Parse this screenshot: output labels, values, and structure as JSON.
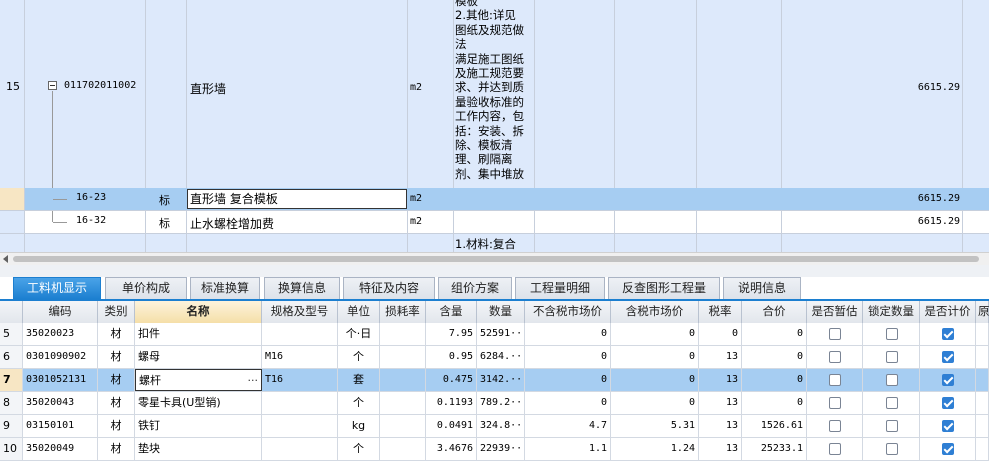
{
  "upper": {
    "row15": {
      "index": "15",
      "code": "011702011002",
      "name": "直形墙",
      "unit": "m2",
      "desc": [
        "模板",
        "2.其他:详见",
        "图纸及规范做",
        "法",
        "满足施工图纸",
        "及施工规范要",
        "求、并达到质",
        "量验收标准的",
        "工作内容，包",
        "括：安装、拆",
        "除、模板清",
        "理、刷隔离",
        "剂、集中堆放"
      ],
      "amount": "6615.29"
    },
    "sub_rows": [
      {
        "code": "16-23",
        "type": "标",
        "name": "直形墙 复合模板",
        "unit": "m2",
        "amount": "6615.29"
      },
      {
        "code": "16-32",
        "type": "标",
        "name": "止水螺栓增加费",
        "unit": "m2",
        "amount": "6615.29"
      }
    ],
    "next_desc": "1.材料:复合"
  },
  "tabs": [
    "工料机显示",
    "单价构成",
    "标准换算",
    "换算信息",
    "特征及内容",
    "组价方案",
    "工程量明细",
    "反查图形工程量",
    "说明信息"
  ],
  "columns": [
    "编码",
    "类别",
    "名称",
    "规格及型号",
    "单位",
    "损耗率",
    "含量",
    "数量",
    "不含税市场价",
    "含税市场价",
    "税率",
    "合价",
    "是否暂估",
    "锁定数量",
    "是否计价",
    "原"
  ],
  "rows": [
    {
      "idx": "5",
      "code": "35020023",
      "type": "材",
      "name": "扣件",
      "spec": "",
      "unit": "个·日",
      "loss": "",
      "content": "7.95",
      "qty": "52591···",
      "price_ex": "0",
      "price_in": "0",
      "tax": "0",
      "total": "0",
      "est": false,
      "lock": false,
      "priced": true
    },
    {
      "idx": "6",
      "code": "0301090902",
      "type": "材",
      "name": "螺母",
      "spec": "M16",
      "unit": "个",
      "loss": "",
      "content": "0.95",
      "qty": "6284.···",
      "price_ex": "0",
      "price_in": "0",
      "tax": "13",
      "total": "0",
      "est": false,
      "lock": false,
      "priced": true
    },
    {
      "idx": "7",
      "code": "0301052131",
      "type": "材",
      "name": "螺杆",
      "spec": "T16",
      "unit": "套",
      "loss": "",
      "content": "0.475",
      "qty": "3142.···",
      "price_ex": "0",
      "price_in": "0",
      "tax": "13",
      "total": "0",
      "est": false,
      "lock": false,
      "priced": true
    },
    {
      "idx": "8",
      "code": "35020043",
      "type": "材",
      "name": "零星卡具(U型销)",
      "spec": "",
      "unit": "个",
      "loss": "",
      "content": "0.1193",
      "qty": "789.2···",
      "price_ex": "0",
      "price_in": "0",
      "tax": "13",
      "total": "0",
      "est": false,
      "lock": false,
      "priced": true
    },
    {
      "idx": "9",
      "code": "03150101",
      "type": "材",
      "name": "铁钉",
      "spec": "",
      "unit": "kg",
      "loss": "",
      "content": "0.0491",
      "qty": "324.8···",
      "price_ex": "4.7",
      "price_in": "5.31",
      "tax": "13",
      "total": "1526.61",
      "est": false,
      "lock": false,
      "priced": true
    },
    {
      "idx": "10",
      "code": "35020049",
      "type": "材",
      "name": "垫块",
      "spec": "",
      "unit": "个",
      "loss": "",
      "content": "3.4676",
      "qty": "22939···",
      "price_ex": "1.1",
      "price_in": "1.24",
      "tax": "13",
      "total": "25233.1",
      "est": false,
      "lock": false,
      "priced": true
    }
  ],
  "selected_row": 2,
  "ellipsis": "···"
}
